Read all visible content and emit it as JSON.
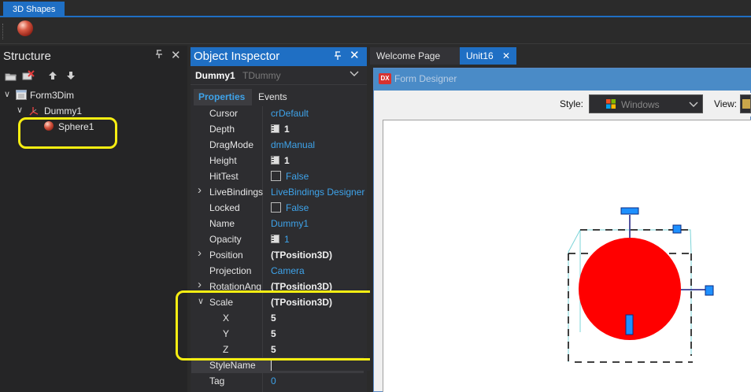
{
  "palette": {
    "tab_label": "3D Shapes",
    "sphere_icon": "sphere-icon"
  },
  "structure": {
    "title": "Structure",
    "pin": "ᵖ",
    "close": "✕",
    "tree": [
      {
        "label": "Form3Dim",
        "icon": "form-icon"
      },
      {
        "label": "Dummy1",
        "icon": "dummy-icon"
      },
      {
        "label": "Sphere1",
        "icon": "sphere-icon"
      }
    ]
  },
  "inspector": {
    "title": "Object Inspector",
    "object_name": "Dummy1",
    "object_type": "TDummy",
    "tab_properties": "Properties",
    "tab_events": "Events",
    "properties": [
      {
        "name": "Cursor",
        "value": "crDefault",
        "style": "link"
      },
      {
        "name": "Depth",
        "value": "1",
        "style": "num"
      },
      {
        "name": "DragMode",
        "value": "dmManual",
        "style": "link"
      },
      {
        "name": "Height",
        "value": "1",
        "style": "num"
      },
      {
        "name": "HitTest",
        "value": "False",
        "style": "check"
      },
      {
        "name": "LiveBindings",
        "value": "LiveBindings Designer",
        "style": "link",
        "expand": true
      },
      {
        "name": "Locked",
        "value": "False",
        "style": "check"
      },
      {
        "name": "Name",
        "value": "Dummy1",
        "style": "link"
      },
      {
        "name": "Opacity",
        "value": "1",
        "style": "numlink"
      },
      {
        "name": "Position",
        "value": "(TPosition3D)",
        "style": "bold",
        "expand": true
      },
      {
        "name": "Projection",
        "value": "Camera",
        "style": "link"
      },
      {
        "name": "RotationAng",
        "value": "(TPosition3D)",
        "style": "bold",
        "expand": true
      },
      {
        "name": "Scale",
        "value": "(TPosition3D)",
        "style": "bold",
        "expanded": true
      },
      {
        "name": "X",
        "value": "5",
        "style": "bold",
        "sub": true
      },
      {
        "name": "Y",
        "value": "5",
        "style": "bold",
        "sub": true
      },
      {
        "name": "Z",
        "value": "5",
        "style": "bold",
        "sub": true
      },
      {
        "name": "StyleName",
        "value": "",
        "style": "selected"
      },
      {
        "name": "Tag",
        "value": "0",
        "style": "link"
      }
    ]
  },
  "editor": {
    "tab_welcome": "Welcome Page",
    "tab_unit": "Unit16",
    "form_designer_title": "Form Designer",
    "form_designer_logo": "DX",
    "style_label": "Style:",
    "style_value": "Windows",
    "view_label": "View:"
  },
  "colors": {
    "accent": "#1f6fc4",
    "highlight": "#f7ee12",
    "sphere": "#ff0000",
    "link": "#3ea3ea"
  }
}
